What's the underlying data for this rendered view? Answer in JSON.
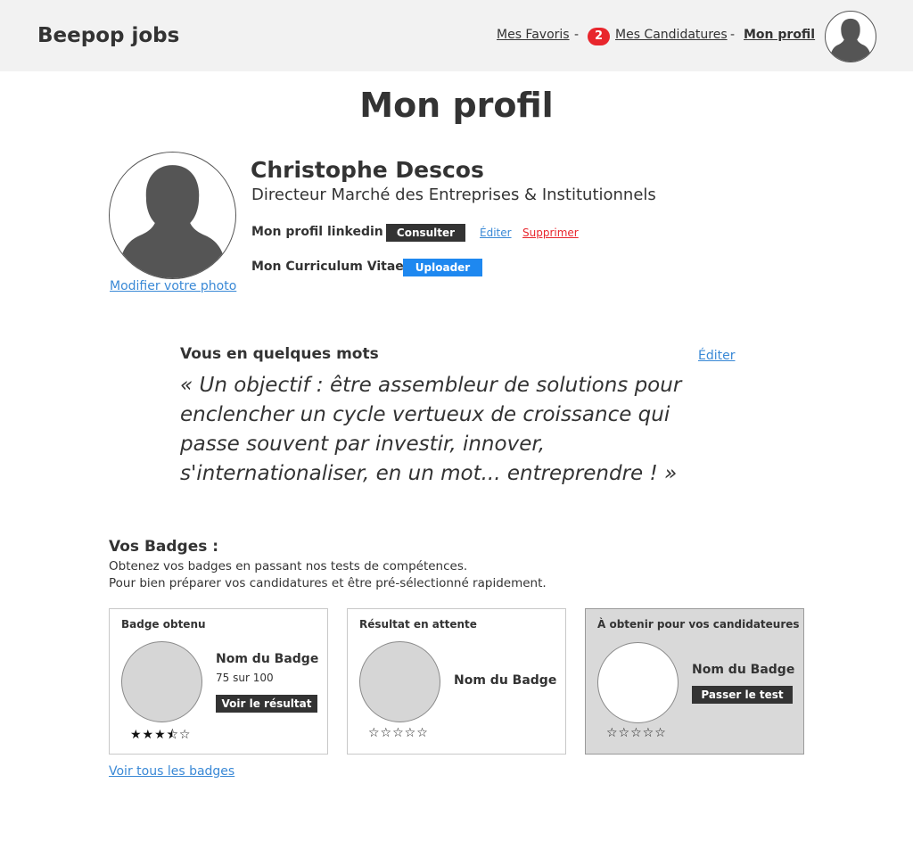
{
  "colors": {
    "header_bg": "#f2f2f2",
    "link_blue": "#3a89d6",
    "delete_red": "#e8262d",
    "upload_blue": "#1e88f0",
    "dark_button": "#333333",
    "count_badge": "#e8262d"
  },
  "header": {
    "brand": "Beepop jobs",
    "nav": {
      "favorites": "Mes Favoris",
      "separator": "-",
      "applications_count": "2",
      "applications": "Mes Candidatures",
      "profile": "Mon profil"
    },
    "avatar_icon": "user-silhouette-icon"
  },
  "page": {
    "title": "Mon profil"
  },
  "profile": {
    "photo_icon": "user-silhouette-icon",
    "change_photo": "Modifier votre photo",
    "name": "Christophe Descos",
    "job_title": "Directeur Marché des Entreprises & Institutionnels",
    "linkedin": {
      "label": "Mon profil linkedin :",
      "view": "Consulter",
      "edit": "Éditer",
      "delete": "Supprimer"
    },
    "cv": {
      "label": "Mon Curriculum Vitae :",
      "upload": "Uploader"
    }
  },
  "about": {
    "heading": "Vous en quelques mots",
    "edit": "Éditer",
    "quote": "« Un objectif : être assembleur de solutions pour enclencher un cycle vertueux de croissance qui passe souvent par investir, innover, s'internationaliser, en un mot... entreprendre ! »"
  },
  "badges": {
    "heading": "Vos Badges :",
    "desc_line1": "Obtenez vos badges en passant nos tests de compétences.",
    "desc_line2": "Pour bien préparer vos candidatures et être pré-sélectionné rapidement.",
    "cards": [
      {
        "label": "Badge obtenu",
        "name": "Nom du Badge",
        "score": "75 sur 100",
        "button": "Voir le résultat",
        "stars": "★★★⯪☆",
        "rating": 3.5
      },
      {
        "label": "Résultat en attente",
        "name": "Nom du Badge",
        "stars": "☆☆☆☆☆",
        "rating": 0
      },
      {
        "label": "À obtenir pour vos candidateures",
        "name": "Nom du Badge",
        "button": "Passer le test",
        "stars": "☆☆☆☆☆",
        "rating": 0
      }
    ],
    "see_all": "Voir tous les badges"
  }
}
